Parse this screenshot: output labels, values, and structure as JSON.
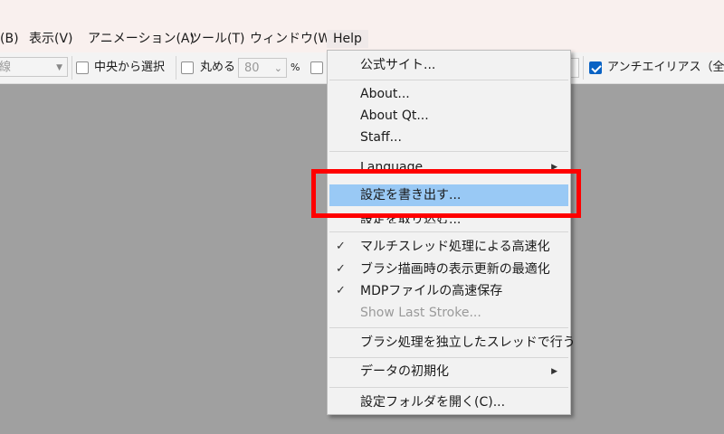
{
  "menubar": {
    "items": [
      "(B)",
      "表示(V)",
      "アニメーション(A)",
      "ツール(T)",
      "ウィンドウ(W)",
      "Help"
    ],
    "active": "Help"
  },
  "toolbar": {
    "combo_text": "線",
    "center_select_label": "中央から選択",
    "round_label": "丸める",
    "round_value": "80",
    "percent_label": "%",
    "antialias_label": "アンチエイリアス（全体"
  },
  "help_menu": {
    "official_site": "公式サイト...",
    "about": "About...",
    "about_qt": "About Qt...",
    "staff": "Staff...",
    "language": "Language",
    "export_settings": "設定を書き出す...",
    "import_settings": "設定を取り込む...",
    "multithread": "マルチスレッド処理による高速化",
    "brush_display": "ブラシ描画時の表示更新の最適化",
    "mdp_save": "MDPファイルの高速保存",
    "show_last_stroke": "Show Last Stroke...",
    "brush_thread": "ブラシ処理を独立したスレッドで行う",
    "reset_data": "データの初期化",
    "open_settings_folder": "設定フォルダを開く(C)..."
  },
  "colors": {
    "highlight": "#99c9f5",
    "annotation": "#ff0000"
  }
}
